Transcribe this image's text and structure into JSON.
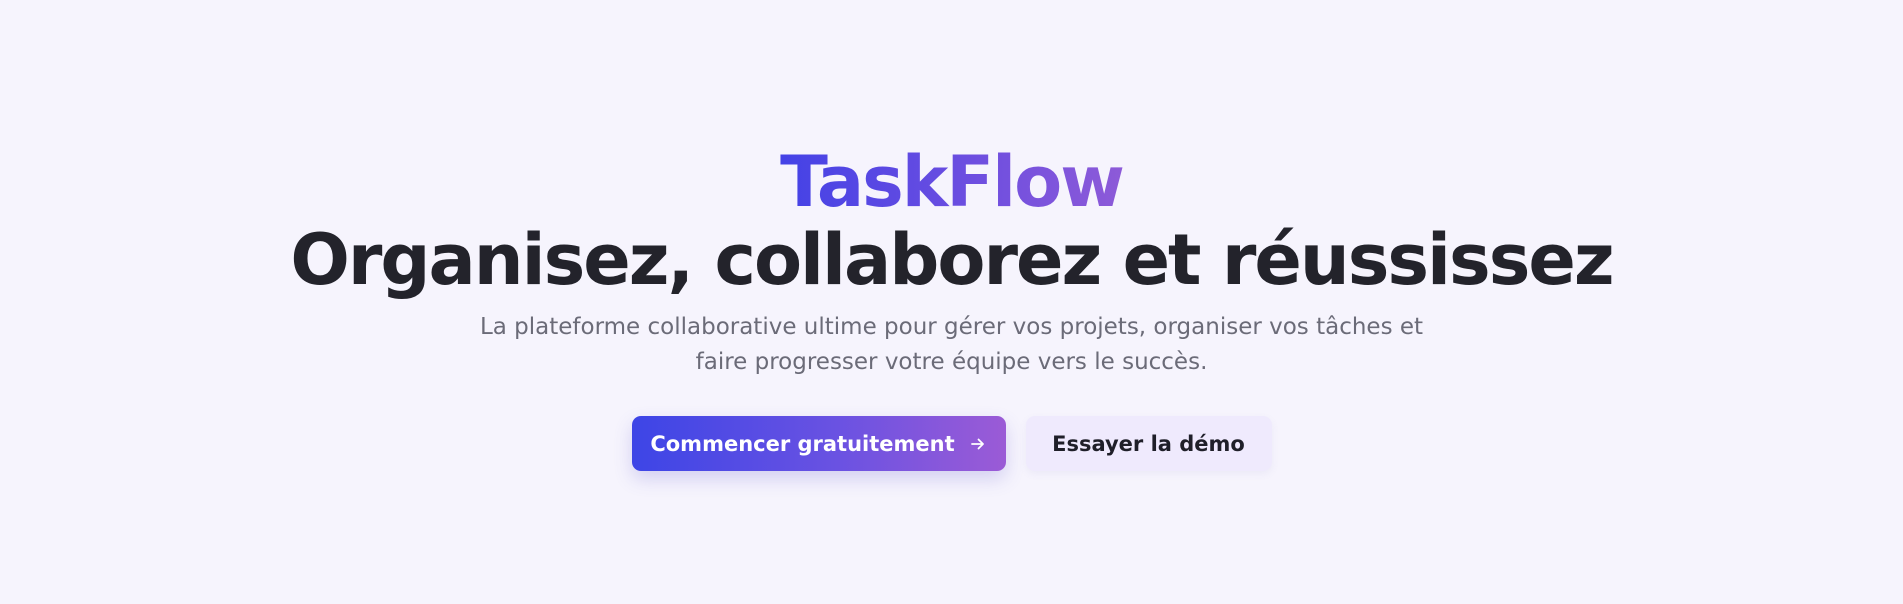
{
  "hero": {
    "brand": "TaskFlow",
    "headline": "Organisez, collaborez et réussissez",
    "subtitle": "La plateforme collaborative ultime pour gérer vos projets, organiser vos tâches et faire progresser votre équipe vers le succès."
  },
  "actions": {
    "primary_label": "Commencer gratuitement",
    "primary_icon": "arrow-right-icon",
    "secondary_label": "Essayer la démo"
  },
  "colors": {
    "background": "#f6f4fd",
    "brand_gradient_start": "#4442e6",
    "brand_gradient_end": "#8d5ad8",
    "headline": "#23232b",
    "subtitle": "#6b6b78",
    "secondary_button_bg": "#efeafd"
  }
}
